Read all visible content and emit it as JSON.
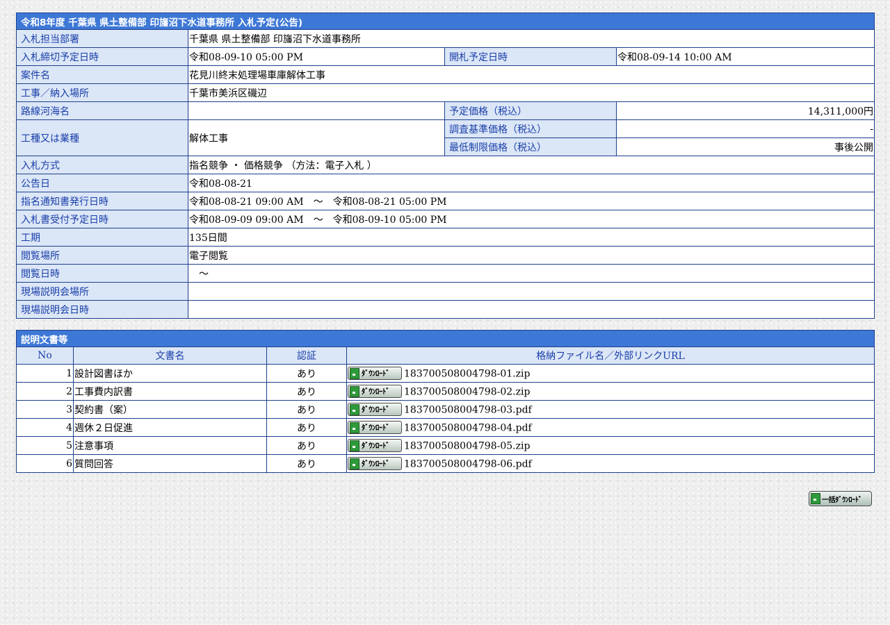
{
  "header": {
    "title": "令和8年度  千葉県  県土整備部  印旛沼下水道事務所  入札予定(公告)"
  },
  "info": {
    "dept_label": "入札担当部署",
    "dept_value": "千葉県  県土整備部  印旛沼下水道事務所",
    "deadline_label": "入札締切予定日時",
    "deadline_value": "令和08-09-10 05:00 PM",
    "opening_label": "開札予定日時",
    "opening_value": "令和08-09-14 10:00 AM",
    "case_label": "案件名",
    "case_value": "花見川終末処理場車庫解体工事",
    "place_label": "工事／納入場所",
    "place_value": "千葉市美浜区磯辺",
    "route_label": "路線河海名",
    "route_value": "",
    "planned_price_label": "予定価格（税込）",
    "planned_price_value": "14,311,000円",
    "type_label": "工種又は業種",
    "type_value": "解体工事",
    "survey_price_label": "調査基準価格（税込）",
    "survey_price_value": "-",
    "min_price_label": "最低制限価格（税込）",
    "min_price_value": "事後公開",
    "method_label": "入札方式",
    "method_value": "指名競争 ・ 価格競争 （方法：電子入札 ）",
    "announce_label": "公告日",
    "announce_value": "令和08-08-21",
    "notice_label": "指名通知書発行日時",
    "notice_value": "令和08-08-21 09:00 AM　～　令和08-08-21 05:00 PM",
    "receipt_label": "入札書受付予定日時",
    "receipt_value": "令和08-09-09 09:00 AM　～　令和08-09-10 05:00 PM",
    "period_label": "工期",
    "period_value": "135日間",
    "view_place_label": "閲覧場所",
    "view_place_value": "電子閲覧",
    "view_date_label": "閲覧日時",
    "view_date_value": "　～",
    "site_place_label": "現場説明会場所",
    "site_place_value": "",
    "site_date_label": "現場説明会日時",
    "site_date_value": ""
  },
  "documents": {
    "title": "説明文書等",
    "headers": {
      "no": "No",
      "name": "文書名",
      "cert": "認証",
      "file": "格納ファイル名／外部リンクURL"
    },
    "download_label": "ﾀﾞｳﾝﾛｰﾄﾞ",
    "rows": [
      {
        "no": "1",
        "name": "設計図書ほか",
        "cert": "あり",
        "file": "183700508004798-01.zip"
      },
      {
        "no": "2",
        "name": "工事費内訳書",
        "cert": "あり",
        "file": "183700508004798-02.zip"
      },
      {
        "no": "3",
        "name": "契約書（案）",
        "cert": "あり",
        "file": "183700508004798-03.pdf"
      },
      {
        "no": "4",
        "name": "週休２日促進",
        "cert": "あり",
        "file": "183700508004798-04.pdf"
      },
      {
        "no": "5",
        "name": "注意事項",
        "cert": "あり",
        "file": "183700508004798-05.zip"
      },
      {
        "no": "6",
        "name": "質問回答",
        "cert": "あり",
        "file": "183700508004798-06.pdf"
      }
    ]
  },
  "bulk_download": {
    "label": "一括ﾀﾞｳﾝﾛｰﾄﾞ"
  },
  "colors": {
    "header_bg": "#3e78d6",
    "label_bg": "#dbe6f7",
    "label_text": "#1a3fa8",
    "border": "#1e3f8c"
  },
  "icons": [
    "download-icon"
  ]
}
